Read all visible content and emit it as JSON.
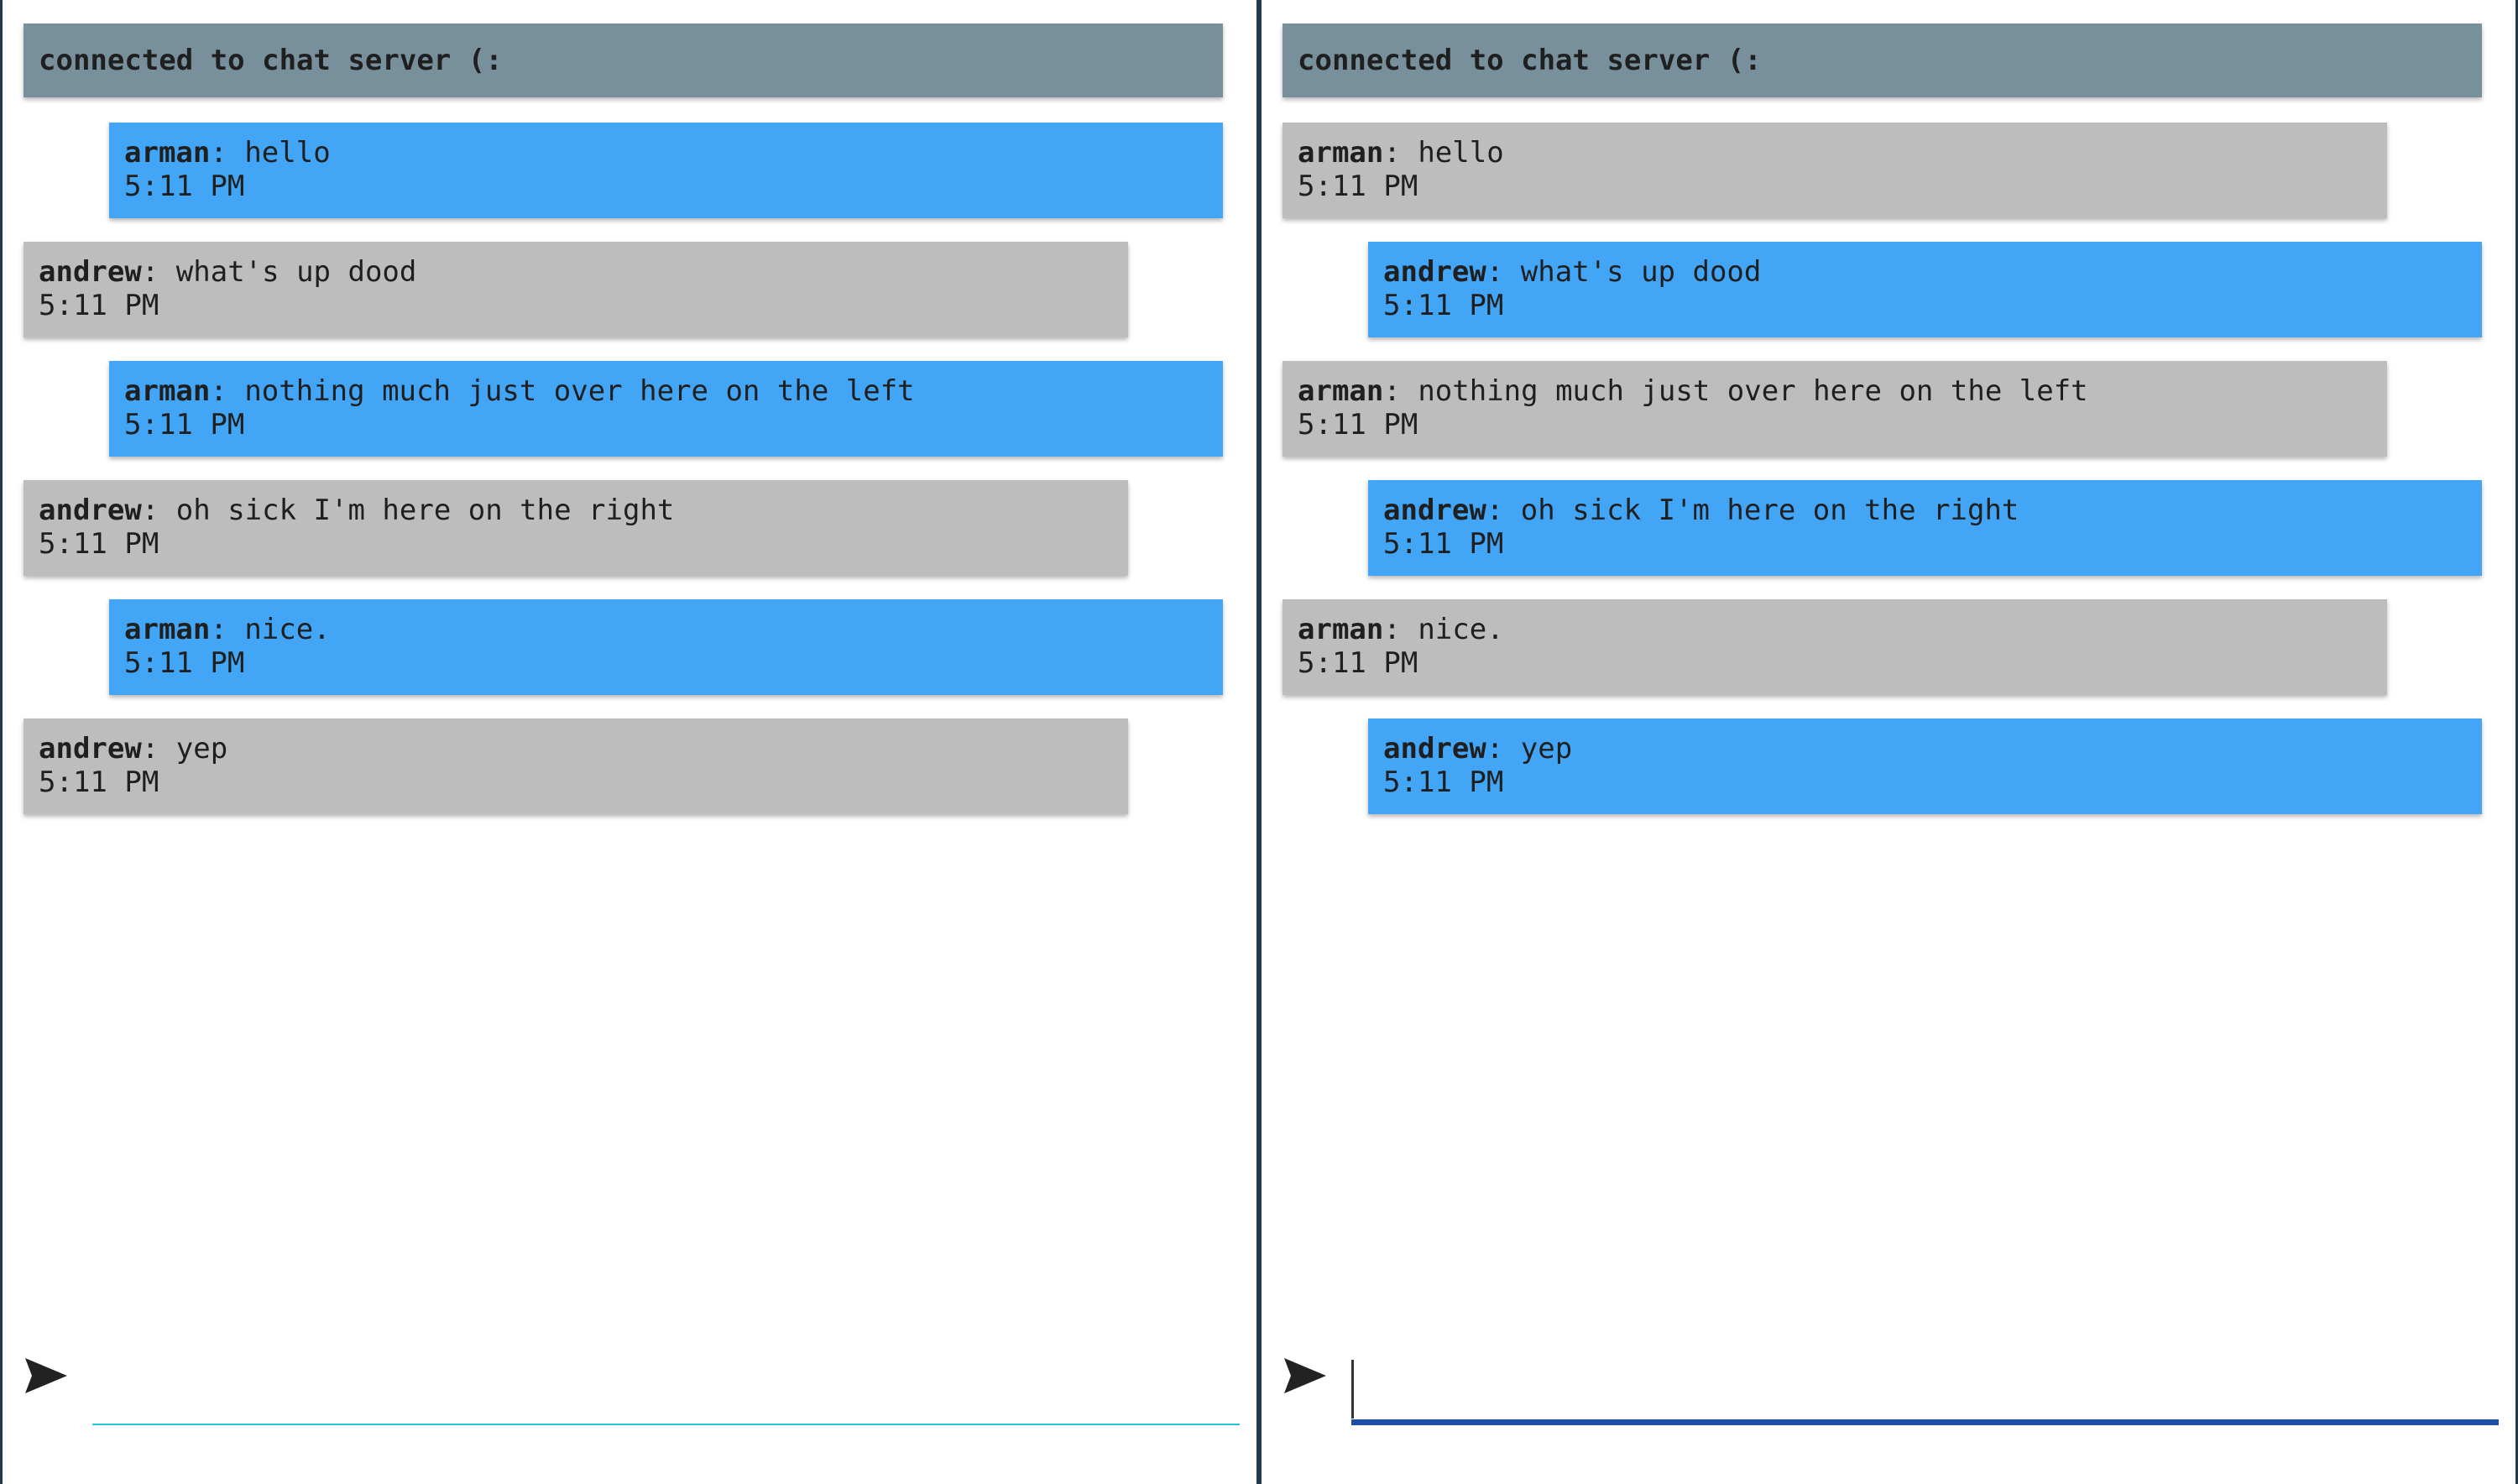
{
  "colors": {
    "banner_bg": "#78909c",
    "own_message_bg": "#42a5f5",
    "other_message_bg": "#bdbdbd",
    "input_underline_idle": "#26c6da",
    "input_underline_focused": "#1e4fa8"
  },
  "panes": [
    {
      "user": "arman",
      "banner": "connected to chat server (:",
      "messages": [
        {
          "sender": "arman",
          "text": "hello",
          "time": "5:11 PM",
          "own": true
        },
        {
          "sender": "andrew",
          "text": "what's up dood",
          "time": "5:11 PM",
          "own": false
        },
        {
          "sender": "arman",
          "text": "nothing much just over here on the left",
          "time": "5:11 PM",
          "own": true
        },
        {
          "sender": "andrew",
          "text": "oh sick I'm here on the right",
          "time": "5:11 PM",
          "own": false
        },
        {
          "sender": "arman",
          "text": "nice.",
          "time": "5:11 PM",
          "own": true
        },
        {
          "sender": "andrew",
          "text": "yep",
          "time": "5:11 PM",
          "own": false
        }
      ],
      "input": {
        "value": "",
        "focused": false,
        "send_icon": "send-icon"
      }
    },
    {
      "user": "andrew",
      "banner": "connected to chat server (:",
      "messages": [
        {
          "sender": "arman",
          "text": "hello",
          "time": "5:11 PM",
          "own": false
        },
        {
          "sender": "andrew",
          "text": "what's up dood",
          "time": "5:11 PM",
          "own": true
        },
        {
          "sender": "arman",
          "text": "nothing much just over here on the left",
          "time": "5:11 PM",
          "own": false
        },
        {
          "sender": "andrew",
          "text": "oh sick I'm here on the right",
          "time": "5:11 PM",
          "own": true
        },
        {
          "sender": "arman",
          "text": "nice.",
          "time": "5:11 PM",
          "own": false
        },
        {
          "sender": "andrew",
          "text": "yep",
          "time": "5:11 PM",
          "own": true
        }
      ],
      "input": {
        "value": "",
        "focused": true,
        "send_icon": "send-icon"
      }
    }
  ]
}
